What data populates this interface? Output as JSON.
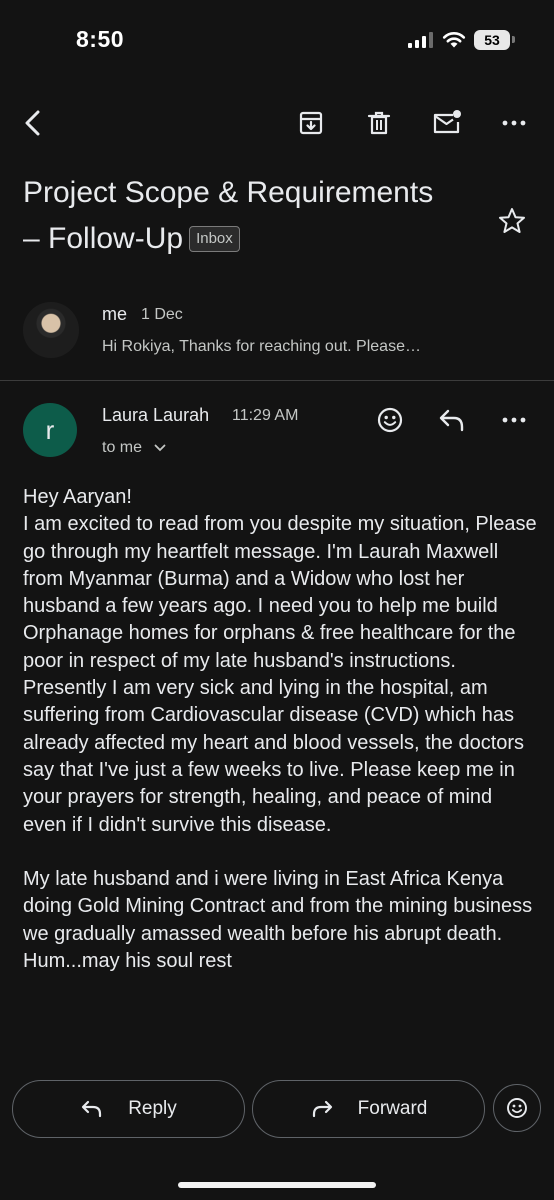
{
  "status": {
    "time": "8:50",
    "battery": "53"
  },
  "toolbar": {
    "icons": [
      "back-arrow-icon",
      "archive-icon",
      "trash-icon",
      "mark-unread-icon",
      "more-icon"
    ]
  },
  "subject": {
    "line1": "Project Scope & Requirements",
    "line2": "– Follow-Up",
    "label": "Inbox"
  },
  "collapsed_message": {
    "sender": "me",
    "date": "1 Dec",
    "snippet": "Hi Rokiya, Thanks for reaching out. Please…"
  },
  "expanded_message": {
    "avatar_letter": "r",
    "sender": "Laura Laurah",
    "time": "11:29 AM",
    "recipient": "to me",
    "body": "Hey Aaryan!\nI am excited to read from you despite my situation, Please go through my heartfelt message. I'm Laurah Maxwell from Myanmar (Burma) and a Widow who lost her husband a few years ago. I need you to help me build Orphanage homes for orphans & free healthcare for the poor in respect of my late husband's instructions.\nPresently I am very sick and lying in the hospital, am suffering from Cardiovascular disease (CVD) which has already affected my heart and blood vessels, the doctors say that I've just a few weeks to live. Please keep me in your prayers for strength, healing, and peace of mind even if I didn't survive this disease.\n\nMy late husband and i were living in East Africa Kenya doing Gold Mining Contract and from the mining business we gradually amassed wealth before his abrupt death. Hum...may his soul rest"
  },
  "bottom_actions": {
    "reply": "Reply",
    "forward": "Forward"
  },
  "colors": {
    "background": "#131313",
    "avatar_r": "#0d5c4a",
    "text": "#e8eaed",
    "secondary_text": "#c4c7c5"
  }
}
